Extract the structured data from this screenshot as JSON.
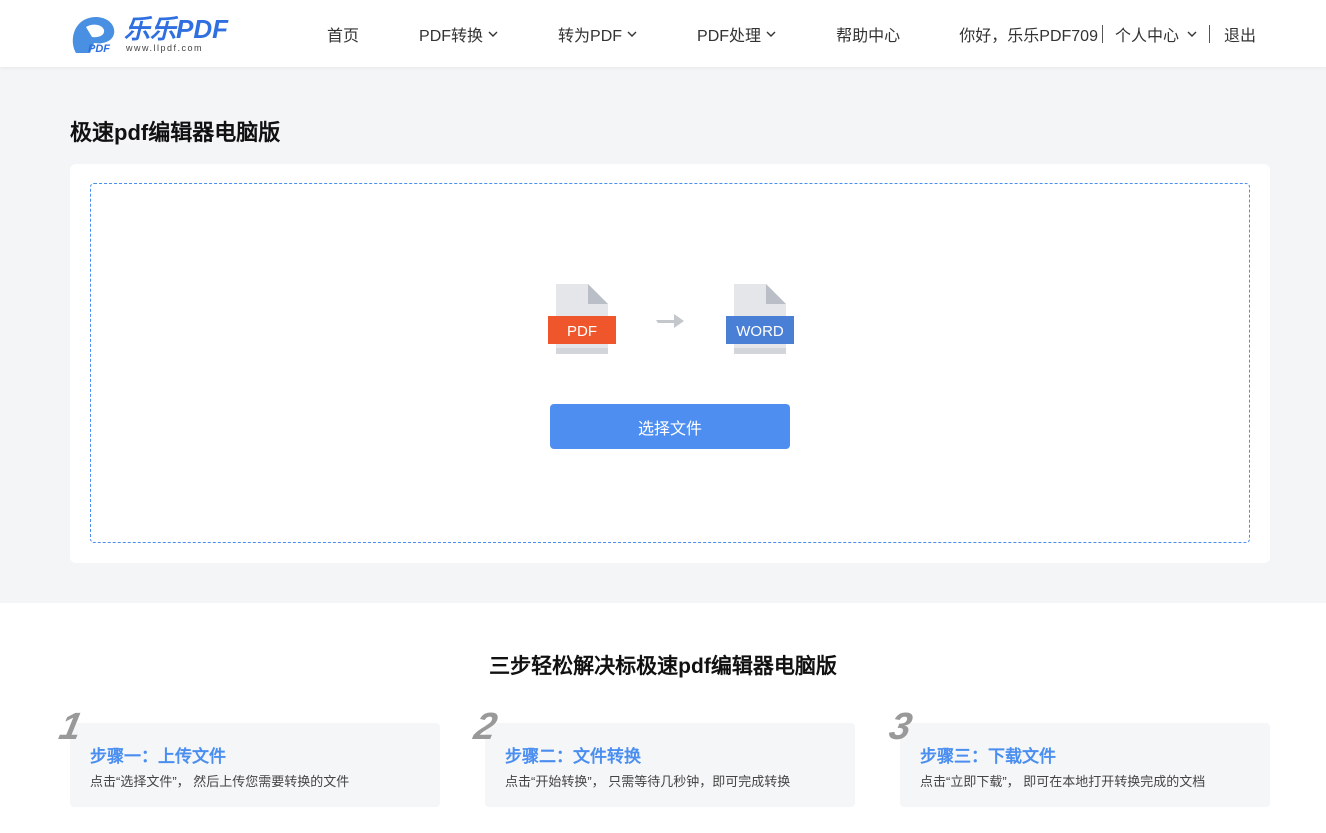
{
  "header": {
    "logo": {
      "title": "乐乐PDF",
      "url": "www.llpdf.com",
      "mark_text": "PDF"
    },
    "nav": [
      {
        "label": "首页",
        "has_dropdown": false
      },
      {
        "label": "PDF转换",
        "has_dropdown": true
      },
      {
        "label": "转为PDF",
        "has_dropdown": true
      },
      {
        "label": "PDF处理",
        "has_dropdown": true
      },
      {
        "label": "帮助中心",
        "has_dropdown": false
      }
    ],
    "user": {
      "greeting": "你好，乐乐PDF709",
      "personal_center": "个人中心",
      "logout": "退出"
    }
  },
  "main": {
    "title": "极速pdf编辑器电脑版",
    "upload": {
      "from_label": "PDF",
      "to_label": "WORD",
      "select_button": "选择文件"
    }
  },
  "steps": {
    "title": "三步轻松解决标极速pdf编辑器电脑版",
    "items": [
      {
        "num": "1",
        "title": "步骤一：上传文件",
        "desc": "点击“选择文件”， 然后上传您需要转换的文件"
      },
      {
        "num": "2",
        "title": "步骤二：文件转换",
        "desc": "点击“开始转换”， 只需等待几秒钟，即可完成转换"
      },
      {
        "num": "3",
        "title": "步骤三：下载文件",
        "desc": "点击“立即下载”， 即可在本地打开转换完成的文档"
      }
    ]
  },
  "colors": {
    "accent": "#4f8ef1",
    "pdf_red": "#f0562b",
    "word_blue": "#4a7fd6",
    "background_gray": "#f4f5f7"
  }
}
